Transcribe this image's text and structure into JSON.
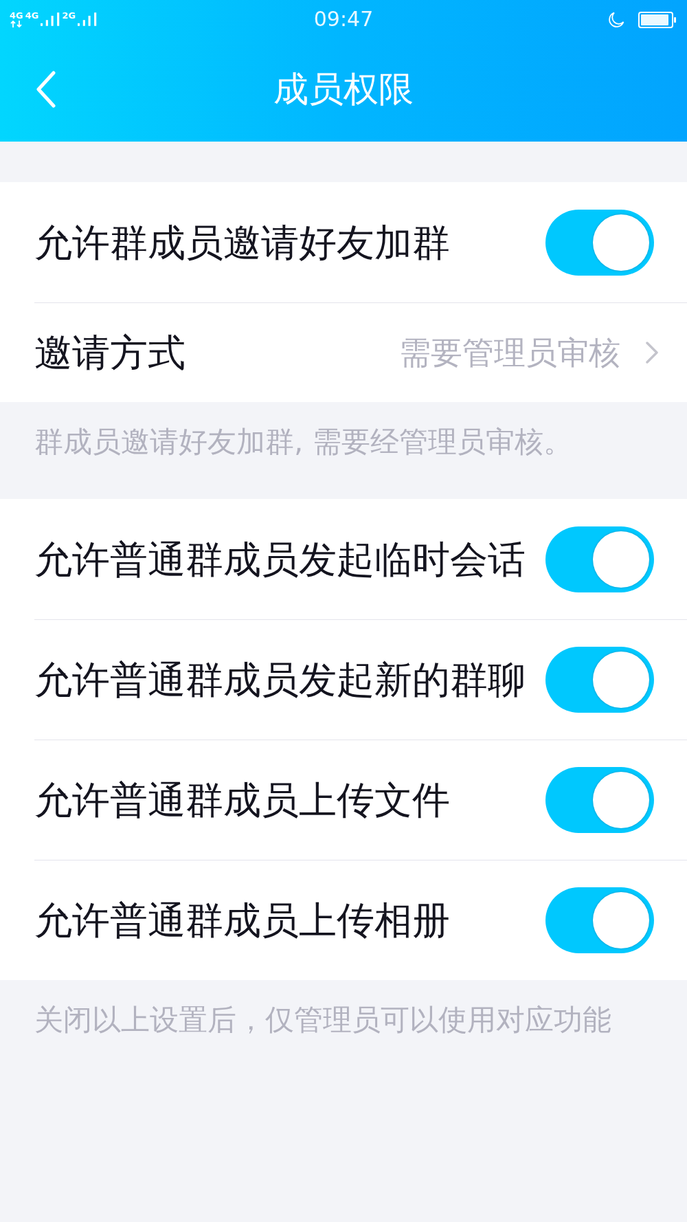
{
  "status_bar": {
    "networks": [
      {
        "kind": "data",
        "label": "4G"
      },
      {
        "kind": "signal",
        "label": "4G"
      },
      {
        "kind": "signal",
        "label": "2G"
      }
    ],
    "time": "09:47"
  },
  "nav_bar": {
    "title": "成员权限"
  },
  "sections": [
    {
      "items": [
        {
          "kind": "toggle",
          "label": "允许群成员邀请好友加群",
          "on": true
        },
        {
          "kind": "link",
          "label": "邀请方式",
          "value": "需要管理员审核"
        }
      ],
      "footer": "群成员邀请好友加群, 需要经管理员审核。"
    },
    {
      "items": [
        {
          "kind": "toggle",
          "label": "允许普通群成员发起临时会话",
          "on": true
        },
        {
          "kind": "toggle",
          "label": "允许普通群成员发起新的群聊",
          "on": true
        },
        {
          "kind": "toggle",
          "label": "允许普通群成员上传文件",
          "on": true
        },
        {
          "kind": "toggle",
          "label": "允许普通群成员上传相册",
          "on": true
        }
      ],
      "footer": "关闭以上设置后，仅管理员可以使用对应功能"
    }
  ]
}
